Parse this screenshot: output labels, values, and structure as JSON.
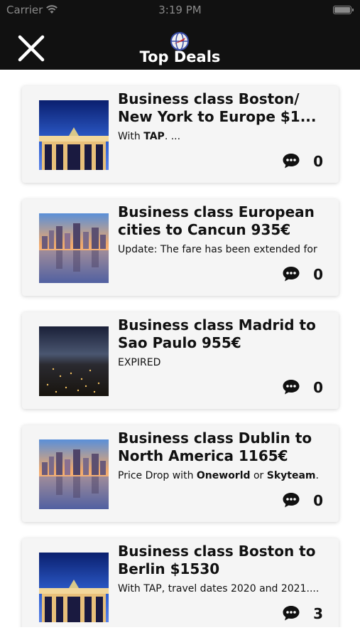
{
  "status_bar": {
    "carrier": "Carrier",
    "time": "3:19 PM"
  },
  "header": {
    "title": "Top Deals",
    "close_icon": "close-icon",
    "logo_icon": "globe-logo-icon"
  },
  "deals": [
    {
      "title_line1": "Business class Boston/",
      "title_line2": "New York to Europe $1...",
      "subtitle_parts": [
        {
          "text": "With ",
          "bold": false
        },
        {
          "text": "TAP",
          "bold": true
        },
        {
          "text": ". ...",
          "bold": false
        }
      ],
      "comment_count": "0",
      "image": "berlin-gate"
    },
    {
      "title_line1": "Business class European",
      "title_line2": "cities to Cancun 935€",
      "subtitle_parts": [
        {
          "text": "Update: The fare has been extended for",
          "bold": false
        }
      ],
      "comment_count": "0",
      "image": "skyline-water"
    },
    {
      "title_line1": "Business class Madrid to",
      "title_line2": "Sao Paulo 955€",
      "subtitle_parts": [
        {
          "text": "EXPIRED",
          "bold": false
        }
      ],
      "comment_count": "0",
      "image": "city-night"
    },
    {
      "title_line1": "Business class Dublin to",
      "title_line2": "North America 1165€",
      "subtitle_parts": [
        {
          "text": "Price Drop with ",
          "bold": false
        },
        {
          "text": "Oneworld",
          "bold": true
        },
        {
          "text": " or ",
          "bold": false
        },
        {
          "text": "Skyteam",
          "bold": true
        },
        {
          "text": ".",
          "bold": false
        }
      ],
      "comment_count": "0",
      "image": "skyline-water"
    },
    {
      "title_line1": "Business class Boston to",
      "title_line2": "Berlin $1530",
      "subtitle_parts": [
        {
          "text": "With TAP, travel dates 2020 and 2021....",
          "bold": false
        }
      ],
      "comment_count": "3",
      "image": "berlin-gate"
    }
  ],
  "colors": {
    "header_bg": "#111111",
    "card_bg": "#f5f5f5",
    "text": "#111111"
  }
}
